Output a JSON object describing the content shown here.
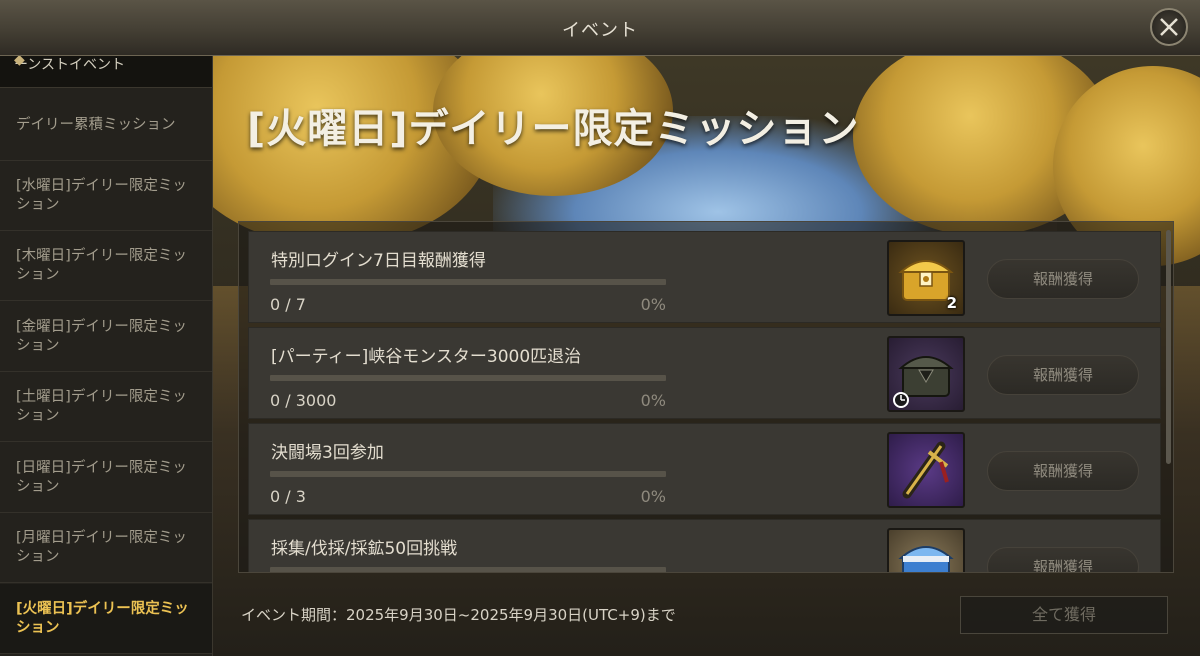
{
  "window": {
    "title": "イベント"
  },
  "sidebar": {
    "clipped_item": "ーンストイベント",
    "items": [
      {
        "label": "デイリー累積ミッション",
        "active": false
      },
      {
        "label": "[水曜日]デイリー限定ミッション",
        "active": false
      },
      {
        "label": "[木曜日]デイリー限定ミッション",
        "active": false
      },
      {
        "label": "[金曜日]デイリー限定ミッション",
        "active": false
      },
      {
        "label": "[土曜日]デイリー限定ミッション",
        "active": false
      },
      {
        "label": "[日曜日]デイリー限定ミッション",
        "active": false
      },
      {
        "label": "[月曜日]デイリー限定ミッション",
        "active": false
      },
      {
        "label": "[火曜日]デイリー限定ミッション",
        "active": true
      }
    ]
  },
  "main": {
    "title": "[火曜日]デイリー限定ミッション",
    "missions": [
      {
        "name": "特別ログイン7日目報酬獲得",
        "progress": "0 / 7",
        "percent": "0%",
        "fill": 0,
        "reward_icon": "golden-chest-icon",
        "reward_qty": "2",
        "claim_label": "報酬獲得"
      },
      {
        "name": "[パーティー]峡谷モンスター3000匹退治",
        "progress": "0 / 3000",
        "percent": "0%",
        "fill": 0,
        "reward_icon": "dark-chest-icon",
        "reward_qty": "",
        "claim_label": "報酬獲得"
      },
      {
        "name": "決闘場3回参加",
        "progress": "0 / 3",
        "percent": "0%",
        "fill": 0,
        "reward_icon": "sword-icon",
        "reward_qty": "",
        "claim_label": "報酬獲得"
      },
      {
        "name": "採集/伐採/採鉱50回挑戦",
        "progress": "",
        "percent": "",
        "fill": 0,
        "reward_icon": "blue-chest-icon",
        "reward_qty": "",
        "claim_label": "報酬獲得"
      }
    ],
    "event_period": "イベント期間：2025年9月30日~2025年9月30日(UTC+9)まで",
    "claim_all_label": "全て獲得"
  },
  "colors": {
    "active_tab": "#ecc253",
    "progress_fill": "#d6a93c"
  }
}
